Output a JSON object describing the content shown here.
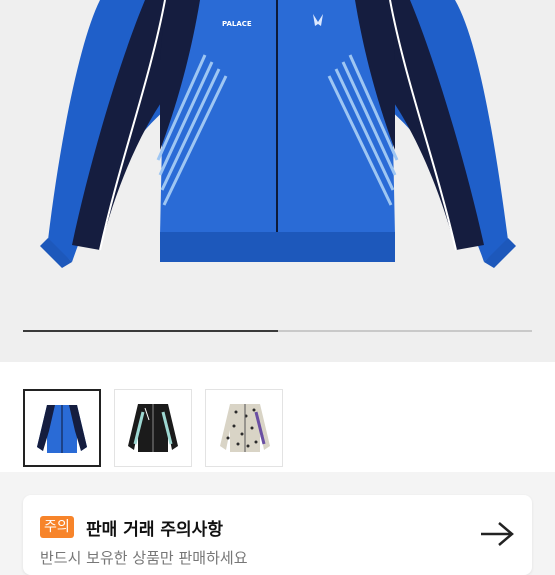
{
  "product": {
    "brand_print": "PALACE",
    "images_total": 3,
    "selected_index": 0,
    "thumbnails": [
      {
        "name": "blue-velour-track-jacket",
        "selected": true
      },
      {
        "name": "black-velour-track-jacket",
        "selected": false
      },
      {
        "name": "leopard-velour-track-jacket",
        "selected": false
      }
    ],
    "gallery_progress_fraction": 0.5
  },
  "notice": {
    "badge": "주의",
    "title": "판매 거래 주의사항",
    "subtitle": "반드시 보유한 상품만 판매하세요",
    "arrow_icon": "arrow-right-icon"
  },
  "colors": {
    "jacket_blue": "#1f5fc9",
    "jacket_navy": "#151d3f",
    "stripe_light": "#7fb2ec",
    "badge_orange": "#f7842a"
  }
}
